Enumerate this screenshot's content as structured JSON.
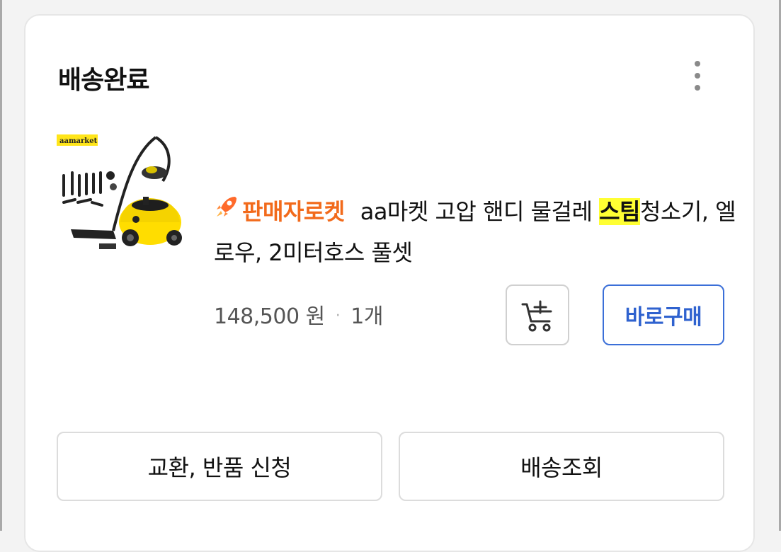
{
  "order": {
    "status": "배송완료",
    "more_icon": "more-vertical-icon"
  },
  "product": {
    "image_brand": "aamarket",
    "badge_icon": "rocket-icon",
    "badge_label": "판매자로켓",
    "name_prefix": "aa마켓 고압 핸디 물걸레 ",
    "name_highlight": "스팀",
    "name_suffix": "청소기, 엘로우, 2미터호스 풀셋",
    "price": "148,500 원",
    "separator": "·",
    "quantity": "1개",
    "highlight_color": "#ffff33",
    "badge_color": "#f26a1b"
  },
  "actions": {
    "cart_icon": "add-to-cart-icon",
    "buy_now_label": "바로구매",
    "exchange_return_label": "교환, 반품 신청",
    "track_delivery_label": "배송조회",
    "accent_color": "#2f62cf"
  }
}
